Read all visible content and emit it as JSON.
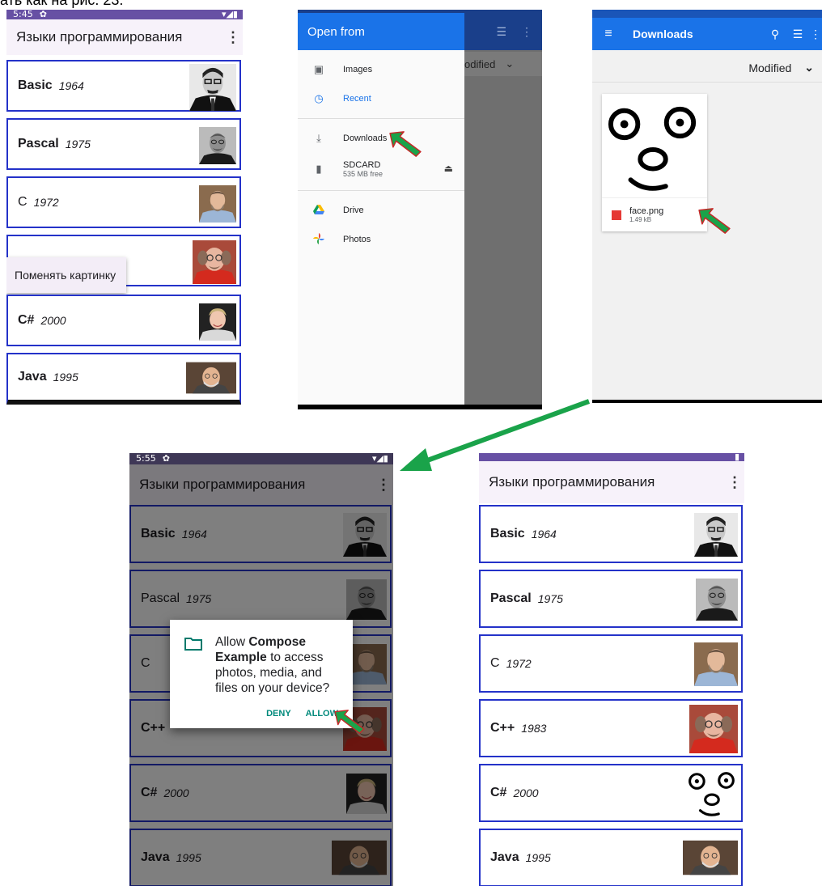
{
  "caption": "ать как на рис. 23.",
  "list_app": {
    "status_time_1": "5:45",
    "status_time_2": "5:55",
    "title": "Языки программирования",
    "menu_icon": "more-vert-icon",
    "items": [
      {
        "name": "Basic",
        "year": "1964"
      },
      {
        "name": "Pascal",
        "year": "1975"
      },
      {
        "name": "C",
        "year": "1972"
      },
      {
        "name": "C++",
        "year": "1983"
      },
      {
        "name": "C#",
        "year": "2000"
      },
      {
        "name": "Java",
        "year": "1995"
      }
    ],
    "context_menu_item": "Поменять картинку"
  },
  "picker": {
    "header": "Open from",
    "items": [
      {
        "label": "Images",
        "icon": "image-icon"
      },
      {
        "label": "Recent",
        "icon": "clock-icon"
      },
      {
        "label": "Downloads",
        "icon": "download-icon"
      },
      {
        "label": "SDCARD",
        "sub": "535 MB free",
        "icon": "sdcard-icon"
      },
      {
        "label": "Drive",
        "icon": "drive-icon"
      },
      {
        "label": "Photos",
        "icon": "photos-icon"
      }
    ],
    "bg_sort_fragment": "odified"
  },
  "downloads": {
    "title": "Downloads",
    "sort_label": "Modified",
    "file_name": "face.png",
    "file_size": "1.49 kB"
  },
  "dialog": {
    "pre": "Allow ",
    "app": "Compose Example",
    "post": " to access photos, media, and files on your device?",
    "deny": "DENY",
    "allow": "ALLOW"
  },
  "colors": {
    "card_border": "#2432c9",
    "status_bar": "#6750a4",
    "picker_blue": "#1a73e8",
    "arrow_green": "#1aa34a",
    "arrow_outline": "#c62828"
  }
}
